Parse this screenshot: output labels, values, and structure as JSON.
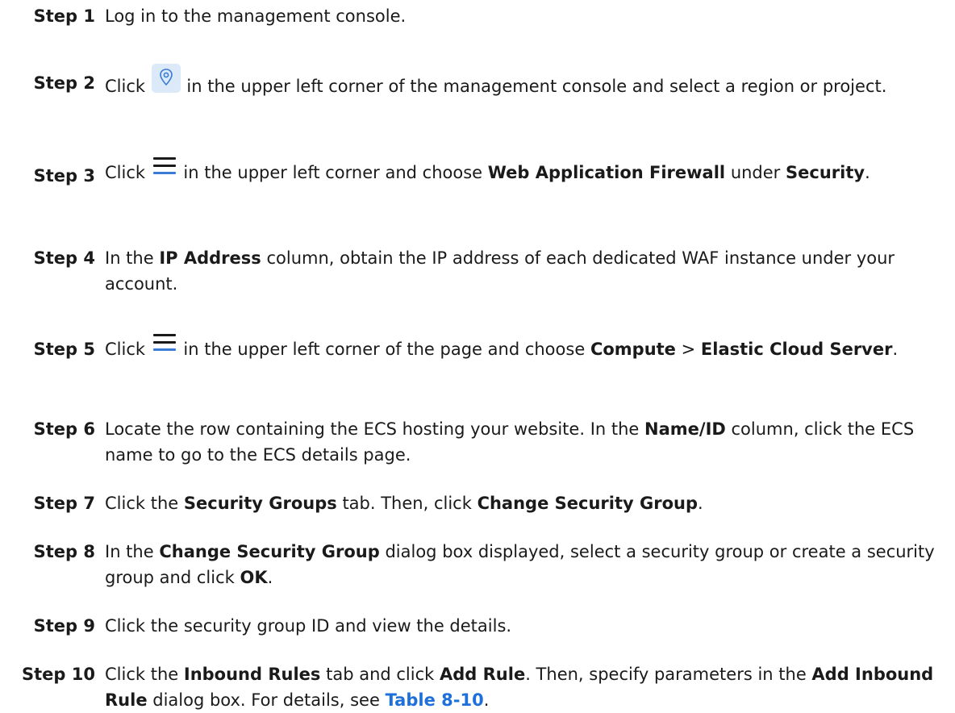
{
  "steps": [
    {
      "label": "Step 1",
      "parts": [
        "Log in to the management console."
      ]
    },
    {
      "label": "Step 2",
      "parts": [
        "Click",
        "in the upper left corner of the management console and select a region or project."
      ]
    },
    {
      "label": "Step 3",
      "parts": [
        "Click",
        "in the upper left corner and choose",
        "Web Application Firewall",
        "under",
        "Security",
        "."
      ]
    },
    {
      "label": "Step 4",
      "parts": [
        "In the",
        "IP Address",
        "column, obtain the IP address of each dedicated WAF instance under your account."
      ]
    },
    {
      "label": "Step 5",
      "parts": [
        "Click",
        "in the upper left corner of the page and choose",
        "Compute",
        ">",
        "Elastic Cloud Server",
        "."
      ]
    },
    {
      "label": "Step 6",
      "parts": [
        "Locate the row containing the ECS hosting your website. In the",
        "Name/ID",
        "column, click the ECS name to go to the ECS details page."
      ]
    },
    {
      "label": "Step 7",
      "parts": [
        "Click the",
        "Security Groups",
        "tab. Then, click",
        "Change Security Group",
        "."
      ]
    },
    {
      "label": "Step 8",
      "parts": [
        "In the",
        "Change Security Group",
        "dialog box displayed, select a security group or create a security group and click",
        "OK",
        "."
      ]
    },
    {
      "label": "Step 9",
      "parts": [
        "Click the security group ID and view the details."
      ]
    },
    {
      "label": "Step 10",
      "parts": [
        "Click the",
        "Inbound Rules",
        "tab and click",
        "Add Rule",
        ". Then, specify parameters in the",
        "Add Inbound Rule",
        "dialog box. For details, see",
        "Table 8-10",
        "."
      ]
    }
  ],
  "icons": {
    "region": "location-pin-icon",
    "menu": "hamburger-menu-icon"
  },
  "colors": {
    "text": "#1a1a1a",
    "link": "#1e6fd9",
    "pin_fill": "#dce9f9",
    "pin_stroke": "#3a7bd5"
  }
}
